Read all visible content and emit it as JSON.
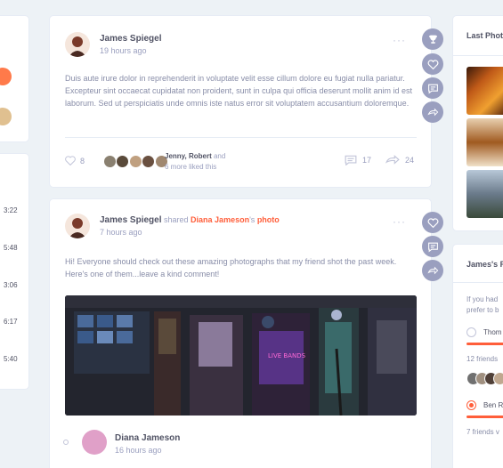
{
  "post1": {
    "author": "James Spiegel",
    "time": "19 hours ago",
    "text": "Duis aute irure dolor in reprehenderit in voluptate velit esse cillum dolore eu fugiat nulla pariatur. Excepteur sint occaecat cupidatat non proident, sunt in culpa qui officia deserunt mollit anim id est laborum. Sed ut perspiciatis unde omnis iste natus error sit voluptatem accusantium doloremque.",
    "likes_count": "8",
    "liked_by_names": "Jenny, Robert",
    "liked_by_and": "and",
    "liked_by_more": "6 more liked this",
    "comments_count": "17",
    "shares_count": "24"
  },
  "post2": {
    "author": "James Spiegel",
    "shared_word": "shared",
    "target_name": "Diana Jameson",
    "possessive": "'s",
    "photo_word": "photo",
    "time": "7 hours ago",
    "text": "Hi! Everyone should check out these amazing photographs that my friend shot the past week. Here's one of them...leave a kind comment!",
    "photo_sign": "LIVE BANDS",
    "shared_author": "Diana Jameson",
    "shared_time": "16 hours ago"
  },
  "left": {
    "times": [
      "3:22",
      "5:48",
      "3:06",
      "6:17",
      "5:40"
    ]
  },
  "right": {
    "last_photos_title": "Last Phot",
    "poll_title": "James's F",
    "poll_question": "If you had\nprefer to b",
    "option1": "Thom",
    "option1_count": "12 friends",
    "option2": "Ben R",
    "option2_count": "7 friends v"
  },
  "icons": {
    "trophy": "trophy-icon",
    "heart": "heart-icon",
    "comment": "comment-icon",
    "share": "share-icon",
    "more": "more-icon"
  },
  "colors": {
    "accent": "#ff5e3a",
    "control": "#9a9fbf",
    "background": "#edf2f6"
  }
}
